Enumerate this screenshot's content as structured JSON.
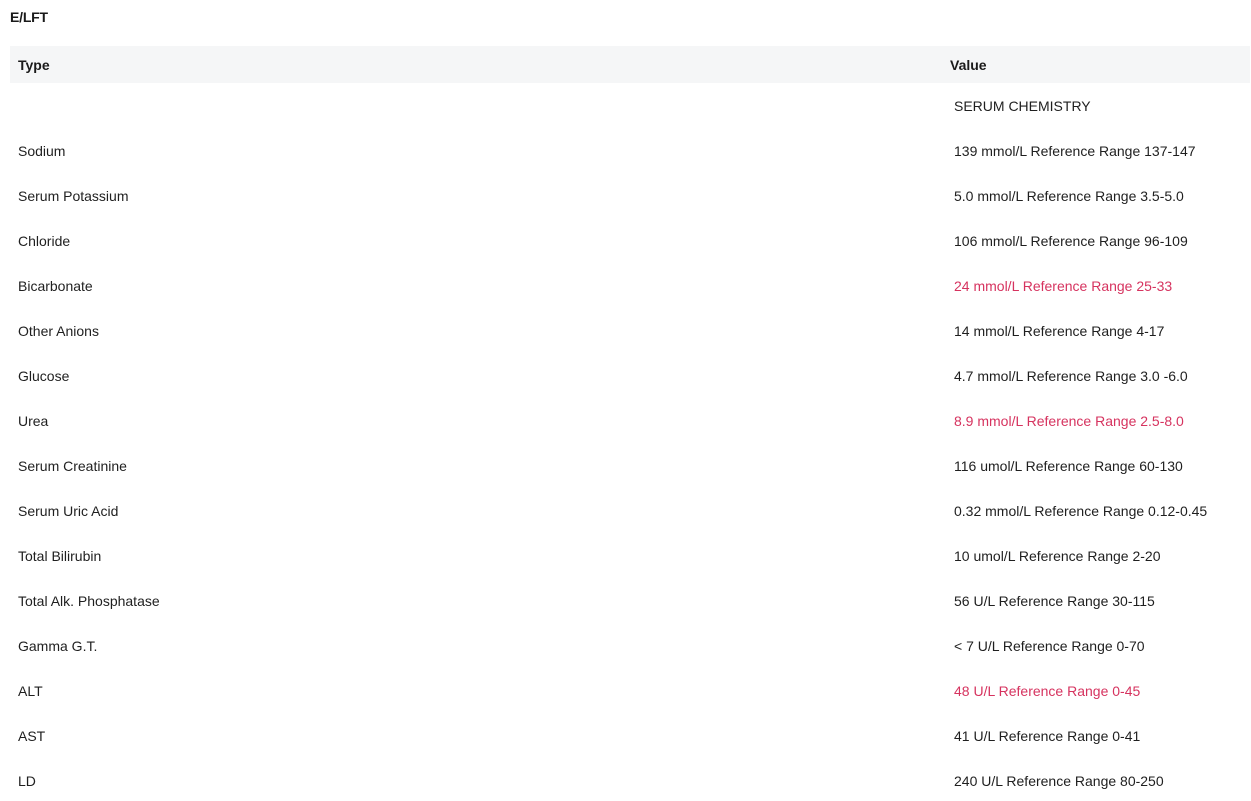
{
  "section": {
    "title": "E/LFT"
  },
  "table": {
    "headers": {
      "type": "Type",
      "value": "Value"
    },
    "rows": [
      {
        "type": "",
        "value": "SERUM CHEMISTRY",
        "abnormal": false
      },
      {
        "type": "Sodium",
        "value": "139 mmol/L Reference Range 137-147",
        "abnormal": false
      },
      {
        "type": "Serum Potassium",
        "value": "5.0 mmol/L Reference Range 3.5-5.0",
        "abnormal": false
      },
      {
        "type": "Chloride",
        "value": "106 mmol/L Reference Range 96-109",
        "abnormal": false
      },
      {
        "type": "Bicarbonate",
        "value": "24 mmol/L Reference Range 25-33",
        "abnormal": true
      },
      {
        "type": "Other Anions",
        "value": "14 mmol/L Reference Range 4-17",
        "abnormal": false
      },
      {
        "type": "Glucose",
        "value": "4.7 mmol/L Reference Range 3.0 -6.0",
        "abnormal": false
      },
      {
        "type": "Urea",
        "value": "8.9 mmol/L Reference Range 2.5-8.0",
        "abnormal": true
      },
      {
        "type": "Serum Creatinine",
        "value": "116 umol/L Reference Range 60-130",
        "abnormal": false
      },
      {
        "type": "Serum Uric Acid",
        "value": "0.32 mmol/L Reference Range 0.12-0.45",
        "abnormal": false
      },
      {
        "type": "Total Bilirubin",
        "value": "10 umol/L Reference Range 2-20",
        "abnormal": false
      },
      {
        "type": "Total Alk. Phosphatase",
        "value": "56 U/L Reference Range 30-115",
        "abnormal": false
      },
      {
        "type": "Gamma G.T.",
        "value": "< 7 U/L Reference Range 0-70",
        "abnormal": false
      },
      {
        "type": "ALT",
        "value": "48 U/L Reference Range 0-45",
        "abnormal": true
      },
      {
        "type": "AST",
        "value": "41 U/L Reference Range 0-41",
        "abnormal": false
      },
      {
        "type": "LD",
        "value": "240 U/L Reference Range 80-250",
        "abnormal": false
      }
    ]
  },
  "colors": {
    "abnormal": "#d6335f",
    "header_bg": "#f5f6f7",
    "text": "#1f1f1f"
  }
}
